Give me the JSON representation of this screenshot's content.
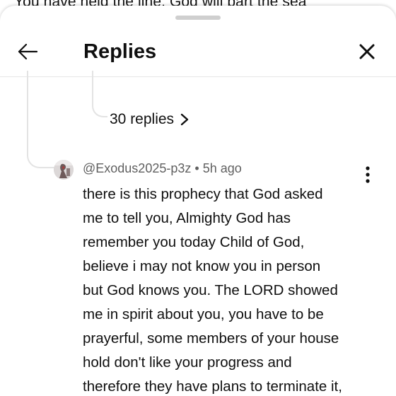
{
  "backdrop": {
    "text": "You have held the line. God will part the sea"
  },
  "sheet": {
    "title": "Replies",
    "back_icon": "arrow-left-icon",
    "close_icon": "close-icon"
  },
  "thread": {
    "replies_label": "30 replies",
    "replies_icon": "chevron-right-icon"
  },
  "comment": {
    "author": "@Exodus2025-p3z",
    "separator": "•",
    "time": "5h ago",
    "more_icon": "more-vertical-icon",
    "lines": [
      "there is this prophecy that God asked",
      "me to tell you, Almighty God has",
      "remember you today Child of God,",
      "believe i may not know you in person",
      "but God knows you. The LORD showed",
      "me in spirit about you, you have to be",
      "prayerful, some members of your house",
      "hold don't like your progress and",
      "therefore they have plans to terminate it,"
    ]
  },
  "colors": {
    "text_primary": "#0f0f0f",
    "text_secondary": "#606060",
    "divider": "#e6e6e6",
    "thread_line": "#e3e3e3",
    "handle": "#cfcfcf"
  }
}
